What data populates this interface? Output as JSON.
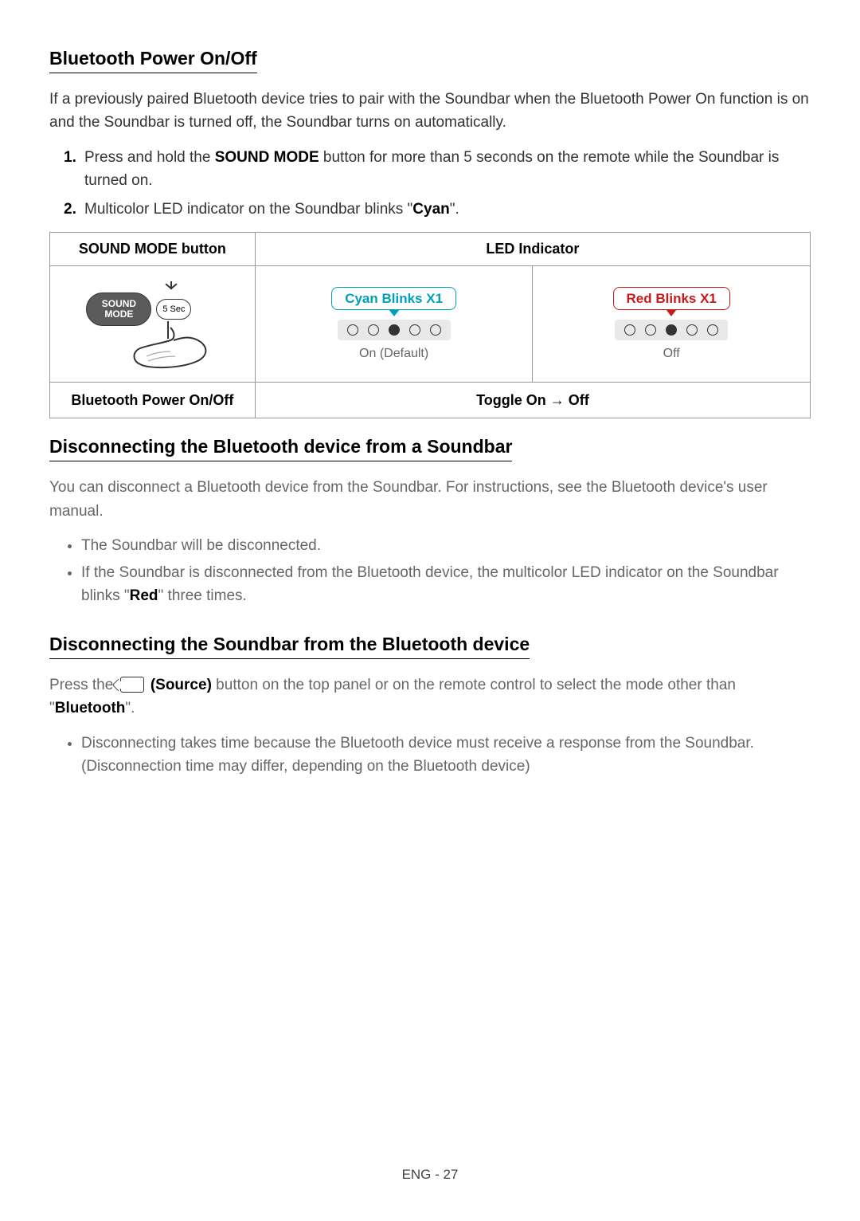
{
  "sections": {
    "bt_power": {
      "heading": "Bluetooth Power On/Off",
      "intro": "If a previously paired Bluetooth device tries to pair with the Soundbar when the Bluetooth Power On function is on and the Soundbar is turned off, the Soundbar turns on automatically.",
      "step1_pre": "Press and hold the ",
      "step1_bold": "SOUND MODE",
      "step1_post": " button for more than 5 seconds on the remote while the Soundbar is turned on.",
      "step2_pre": "Multicolor LED indicator on the Soundbar blinks \"",
      "step2_bold": "Cyan",
      "step2_post": "\"."
    },
    "table": {
      "col1_head": "SOUND MODE button",
      "col2_head": "LED Indicator",
      "pill_label": "SOUND\nMODE",
      "duration": "5 Sec",
      "cyan_title": "Cyan Blinks X1",
      "cyan_sub": "On (Default)",
      "red_title": "Red Blinks X1",
      "red_sub": "Off",
      "row2_left": "Bluetooth Power On/Off",
      "row2_right": "Toggle On → Off"
    },
    "disc_from": {
      "heading": "Disconnecting the Bluetooth device from a Soundbar",
      "intro": "You can disconnect a Bluetooth device from the Soundbar. For instructions, see the Bluetooth device's user manual.",
      "b1": "The Soundbar will be disconnected.",
      "b2_pre": "If the Soundbar is disconnected from the Bluetooth device, the multicolor LED indicator on the Soundbar blinks \"",
      "b2_bold": "Red",
      "b2_post": "\" three times."
    },
    "disc_sb": {
      "heading": "Disconnecting the Soundbar from the Bluetooth device",
      "p_pre": "Press the ",
      "p_bold1": "(Source)",
      "p_mid": " button on the top panel or on the remote control to select the mode other than \"",
      "p_bold2": "Bluetooth",
      "p_post": "\".",
      "b1": "Disconnecting takes time because the Bluetooth device must receive a response from the Soundbar. (Disconnection time may differ, depending on the Bluetooth device)"
    }
  },
  "footer": "ENG - 27"
}
